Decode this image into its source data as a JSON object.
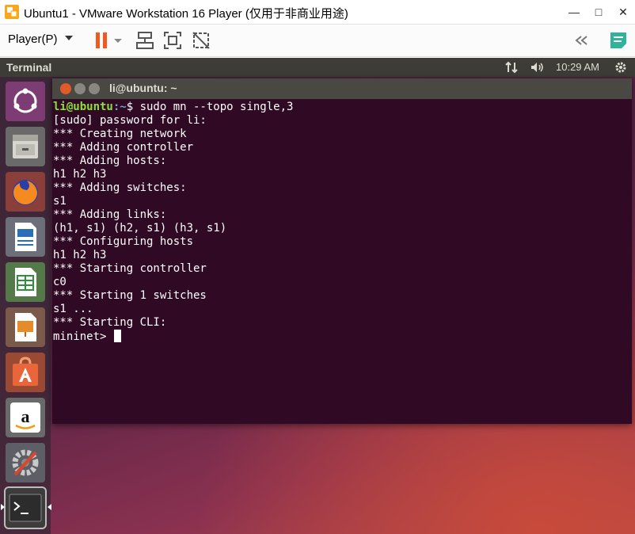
{
  "vmware": {
    "window_title": "Ubuntu1 - VMware Workstation 16 Player (仅用于非商业用途)",
    "minimize": "—",
    "maximize": "□",
    "close": "✕",
    "player_menu": "Player(P)",
    "icons": [
      "pause-icon",
      "dropdown-icon",
      "network-icon",
      "fullscreen-icon",
      "unity-icon",
      "collapse-icon",
      "notes-icon"
    ],
    "accent": "#f05a1e"
  },
  "ubuntu": {
    "topbar_title": "Terminal",
    "clock": "10:29 AM",
    "tray_icons": [
      "network-arrows-icon",
      "volume-icon",
      "gear-icon"
    ],
    "launcher": [
      "ubuntu-logo-icon",
      "files-icon",
      "firefox-icon",
      "writer-icon",
      "calc-icon",
      "impress-icon",
      "software-icon",
      "amazon-icon",
      "settings-icon",
      "terminal-icon"
    ]
  },
  "terminal": {
    "title": "li@ubuntu: ~",
    "prompt_user": "li@ubuntu",
    "prompt_path": ":~",
    "prompt_symbol": "$ ",
    "command": "sudo mn --topo single,3",
    "output": [
      "[sudo] password for li:",
      "*** Creating network",
      "*** Adding controller",
      "*** Adding hosts:",
      "h1 h2 h3",
      "*** Adding switches:",
      "s1",
      "*** Adding links:",
      "(h1, s1) (h2, s1) (h3, s1)",
      "*** Configuring hosts",
      "h1 h2 h3",
      "*** Starting controller",
      "c0",
      "*** Starting 1 switches",
      "s1 ...",
      "*** Starting CLI:"
    ],
    "final_prompt": "mininet> "
  }
}
